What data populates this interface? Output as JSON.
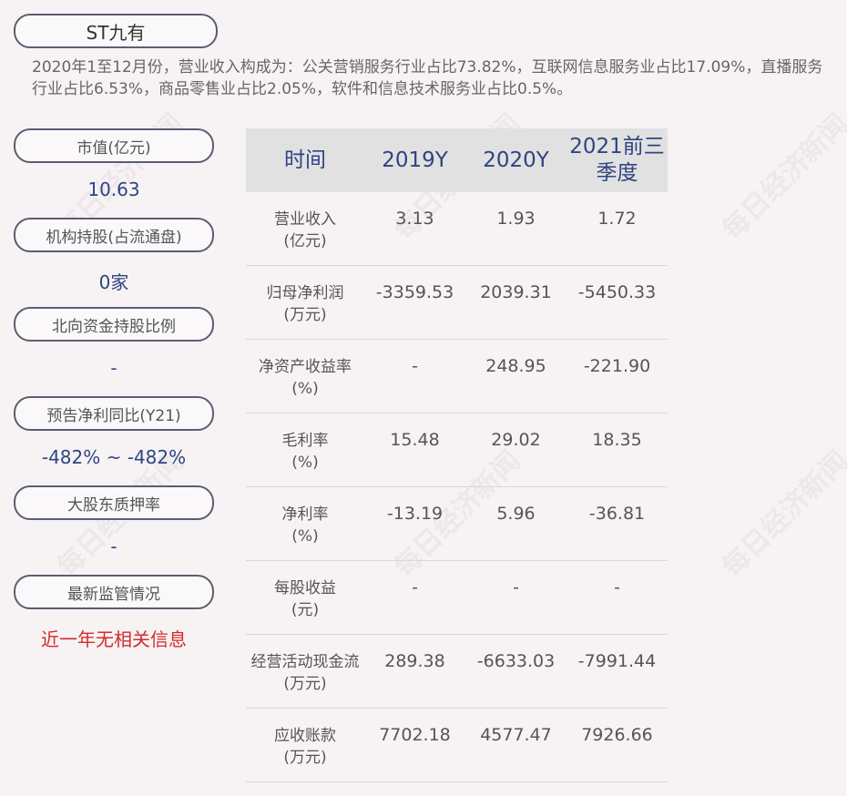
{
  "watermark_text": "每日经济新闻",
  "title": "ST九有",
  "summary": "2020年1至12月份，营业收入构成为：公关营销服务行业占比73.82%，互联网信息服务业占比17.09%，直播服务行业占比6.53%，商品零售业占比2.05%，软件和信息技术服务业占比0.5%。",
  "left_panel": [
    {
      "label": "市值(亿元)",
      "value": "10.63"
    },
    {
      "label": "机构持股(占流通盘)",
      "value": "0家"
    },
    {
      "label": "北向资金持股比例",
      "value": "-"
    },
    {
      "label": "预告净利同比(Y21)",
      "value": "-482% ~ -482%"
    },
    {
      "label": "大股东质押率",
      "value": "-"
    },
    {
      "label": "最新监管情况",
      "value": "近一年无相关信息"
    }
  ],
  "table": {
    "headers": [
      "时间",
      "2019Y",
      "2020Y",
      "2021前三季度"
    ],
    "rows": [
      {
        "label": "营业收入",
        "unit": "(亿元)",
        "values": [
          "3.13",
          "1.93",
          "1.72"
        ]
      },
      {
        "label": "归母净利润",
        "unit": "(万元)",
        "values": [
          "-3359.53",
          "2039.31",
          "-5450.33"
        ]
      },
      {
        "label": "净资产收益率",
        "unit": "(%)",
        "values": [
          "-",
          "248.95",
          "-221.90"
        ]
      },
      {
        "label": "毛利率",
        "unit": "(%)",
        "values": [
          "15.48",
          "29.02",
          "18.35"
        ]
      },
      {
        "label": "净利率",
        "unit": "(%)",
        "values": [
          "-13.19",
          "5.96",
          "-36.81"
        ]
      },
      {
        "label": "每股收益",
        "unit": "(元)",
        "values": [
          "-",
          "-",
          "-"
        ]
      },
      {
        "label": "经营活动现金流",
        "unit": "(万元)",
        "values": [
          "289.38",
          "-6633.03",
          "-7991.44"
        ]
      },
      {
        "label": "应收账款",
        "unit": "(万元)",
        "values": [
          "7702.18",
          "4577.47",
          "7926.66"
        ]
      }
    ]
  }
}
